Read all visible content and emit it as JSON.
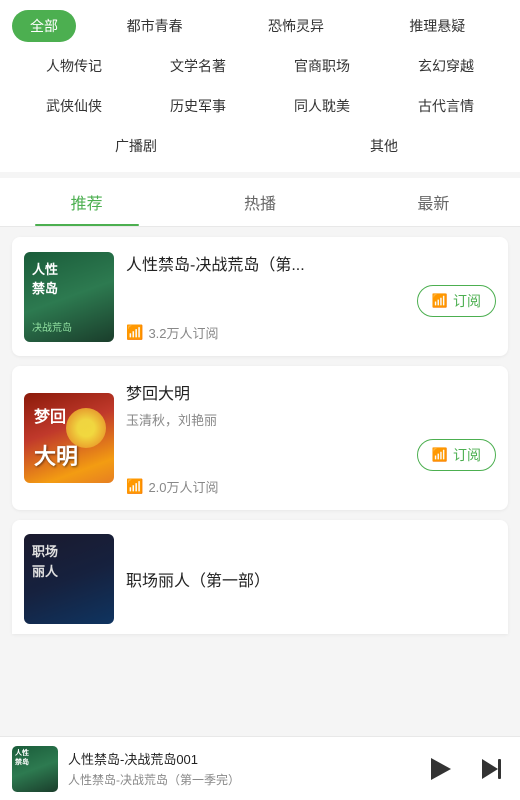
{
  "categories": {
    "row1": [
      {
        "label": "全部",
        "active": true
      },
      {
        "label": "都市青春",
        "active": false
      },
      {
        "label": "恐怖灵异",
        "active": false
      },
      {
        "label": "推理悬疑",
        "active": false
      }
    ],
    "row2": [
      {
        "label": "人物传记",
        "active": false
      },
      {
        "label": "文学名著",
        "active": false
      },
      {
        "label": "官商职场",
        "active": false
      },
      {
        "label": "玄幻穿越",
        "active": false
      }
    ],
    "row3": [
      {
        "label": "武侠仙侠",
        "active": false
      },
      {
        "label": "历史军事",
        "active": false
      },
      {
        "label": "同人耽美",
        "active": false
      },
      {
        "label": "古代言情",
        "active": false
      }
    ],
    "row4": [
      {
        "label": "广播剧",
        "active": false
      },
      {
        "label": "其他",
        "active": false
      }
    ]
  },
  "tabs": [
    {
      "label": "推荐",
      "active": true
    },
    {
      "label": "热播",
      "active": false
    },
    {
      "label": "最新",
      "active": false
    }
  ],
  "books": [
    {
      "title": "人性禁岛-决战荒岛（第...",
      "authors": "",
      "subscribers": "3.2万人订阅",
      "subscribe_label": "订阅",
      "cover_type": "cover1"
    },
    {
      "title": "梦回大明",
      "authors": "玉清秋，刘艳丽",
      "subscribers": "2.0万人订阅",
      "subscribe_label": "订阅",
      "cover_type": "cover2"
    },
    {
      "title": "职场丽人（第一部）",
      "authors": "",
      "subscribers": "",
      "subscribe_label": "",
      "cover_type": "cover3"
    }
  ],
  "player": {
    "title": "人性禁岛-决战荒岛001",
    "subtitle": "人性禁岛-决战荒岛（第一季完）"
  },
  "icons": {
    "subscribe": "📶",
    "play": "▶",
    "next": "⏭"
  }
}
